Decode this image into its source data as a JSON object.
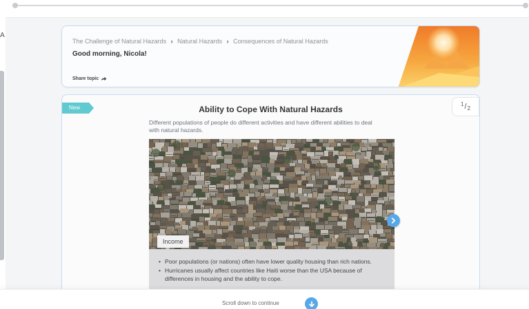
{
  "left_edge": {
    "glyph": "A"
  },
  "header": {
    "breadcrumb": [
      "The Challenge of Natural Hazards",
      "Natural Hazards",
      "Consequences of Natural Hazards"
    ],
    "breadcrumb_separator": "›",
    "greeting": "Good morning, Nicola!",
    "share_label": "Share topic",
    "icons": {
      "share": "share-arrow-icon",
      "art": "desert-sun-illustration"
    }
  },
  "content": {
    "badge": "New",
    "page_current": "1",
    "page_total": "2",
    "title": "Ability to Cope With Natural Hazards",
    "description": "Different populations of people do different activities and have different abilities to deal with natural hazards.",
    "image_label": "Income",
    "bullets": [
      "Poor populations (or nations) often have lower quality housing than rich nations.",
      "Hurricanes usually affect countries like Haiti worse than the USA because of differences in housing and the ability to cope."
    ],
    "icons": {
      "next": "chevron-right-icon"
    }
  },
  "footer": {
    "scroll_text": "Scroll down to continue",
    "icons": {
      "scroll": "arrow-down-icon"
    }
  },
  "colors": {
    "accent_blue": "#58a8e8",
    "badge_teal": "#5fcad0",
    "card_border": "#c8dcf2",
    "art_orange": "#f2a13a"
  }
}
